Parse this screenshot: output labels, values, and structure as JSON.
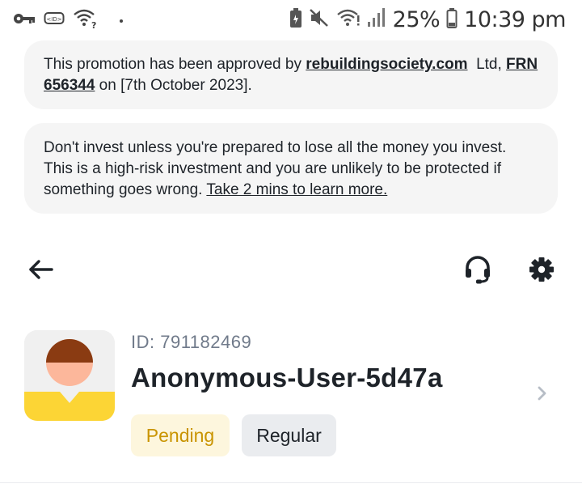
{
  "status_bar": {
    "left_icons": [
      "key-icon",
      "vpn-icon",
      "wifi-question-icon",
      "notification-dot-icon"
    ],
    "right_icons": [
      "battery-saver-icon",
      "mute-icon",
      "wifi-icon",
      "signal-icon",
      "battery-icon"
    ],
    "battery_percent": "25%",
    "time": "10:39 pm"
  },
  "promo_banner": {
    "text_before": "This promotion has been approved by ",
    "link_domain": "rebuildingsociety.com",
    "text_mid": "  Ltd, ",
    "link_frn": "FRN 656344",
    "text_after": " on [7th October 2023]."
  },
  "risk_banner": {
    "text": "Don't invest unless you're prepared to lose all the money you invest. This is a high-risk investment and you are unlikely to be protected if something goes wrong. ",
    "link": "Take 2 mins to learn more."
  },
  "nav": {
    "back_icon": "back-arrow-icon",
    "support_icon": "headset-icon",
    "settings_icon": "gear-icon"
  },
  "profile": {
    "id_label": "ID: 791182469",
    "username": "Anonymous-User-5d47a",
    "badges": {
      "pending": "Pending",
      "regular": "Regular"
    },
    "colors": {
      "avatar_hair": "#8a3b12",
      "avatar_face": "#fcb79b",
      "avatar_body": "#fcd535",
      "pending_text": "#c99400",
      "pending_bg": "#fdf6dd"
    }
  }
}
